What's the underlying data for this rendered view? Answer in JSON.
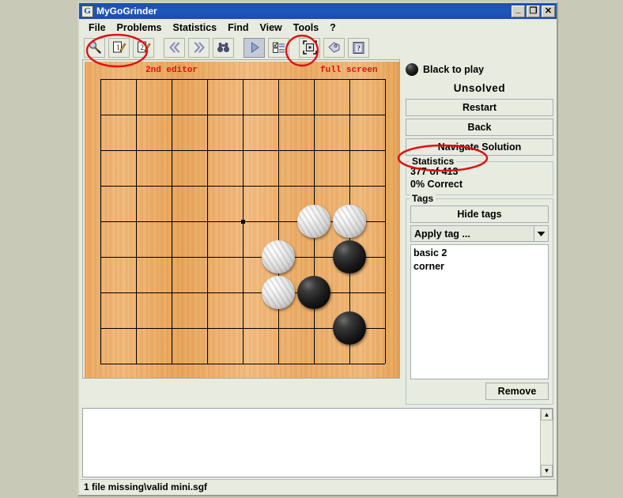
{
  "window": {
    "title": "MyGoGrinder",
    "icon": "app-icon",
    "controls": {
      "minimize": "_",
      "maximize": "❐",
      "close": "✕"
    }
  },
  "menubar": {
    "items": [
      {
        "label": "File",
        "name": "menu-file"
      },
      {
        "label": "Problems",
        "name": "menu-problems"
      },
      {
        "label": "Statistics",
        "name": "menu-statistics"
      },
      {
        "label": "Find",
        "name": "menu-find"
      },
      {
        "label": "View",
        "name": "menu-view"
      },
      {
        "label": "Tools",
        "name": "menu-tools"
      },
      {
        "label": "?",
        "name": "menu-help"
      }
    ]
  },
  "toolbar": {
    "buttons": [
      {
        "name": "magnifier-brush-icon",
        "icon": "magnifier-brush",
        "selected": false
      },
      {
        "name": "editor-1-icon",
        "icon": "edit-1",
        "selected": false
      },
      {
        "name": "editor-2-icon",
        "icon": "edit-2",
        "selected": false
      },
      {
        "name": "previous-problem-icon",
        "icon": "double-chevron-left",
        "selected": false
      },
      {
        "name": "next-problem-icon",
        "icon": "double-chevron-right",
        "selected": false
      },
      {
        "name": "search-binoculars-icon",
        "icon": "binoculars",
        "selected": false
      },
      {
        "name": "play-icon",
        "icon": "play-triangle",
        "selected": true
      },
      {
        "name": "problem-list-icon",
        "icon": "checklist",
        "selected": false
      },
      {
        "name": "full-screen-icon",
        "icon": "fullscreen-brackets",
        "selected": false
      },
      {
        "name": "tag-icon",
        "icon": "tag-label",
        "selected": false
      },
      {
        "name": "help-icon",
        "icon": "question-book",
        "selected": false
      }
    ]
  },
  "annotations": [
    {
      "text": "2nd editor",
      "name": "annotation-2nd-editor",
      "color": "#e01010"
    },
    {
      "text": "full screen",
      "name": "annotation-full-screen",
      "color": "#e01010"
    }
  ],
  "board": {
    "size": 9,
    "star_points": [
      {
        "col": 5,
        "row": 5
      }
    ],
    "stones": [
      {
        "color": "white",
        "col": 7,
        "row": 5
      },
      {
        "color": "white",
        "col": 8,
        "row": 5
      },
      {
        "color": "black",
        "col": 8,
        "row": 6
      },
      {
        "color": "white",
        "col": 6,
        "row": 6
      },
      {
        "color": "white",
        "col": 6,
        "row": 7
      },
      {
        "color": "black",
        "col": 7,
        "row": 7
      },
      {
        "color": "black",
        "col": 8,
        "row": 8
      }
    ],
    "wood_color": "#e9a963",
    "line_color": "#000000"
  },
  "side": {
    "turn": {
      "label": "Black to play",
      "stone": "black"
    },
    "solve_status": "Unsolved",
    "buttons": [
      {
        "label": "Restart",
        "name": "restart-button"
      },
      {
        "label": "Back",
        "name": "back-button"
      },
      {
        "label": "Navigate Solution",
        "name": "navigate-solution-button"
      }
    ],
    "statistics": {
      "legend": "Statistics",
      "progress": "377 of 413",
      "correct": "0% Correct"
    },
    "tags": {
      "legend": "Tags",
      "hide_button": "Hide tags",
      "combo_value": "Apply tag ...",
      "items": [
        "basic 2",
        "corner"
      ],
      "remove_button": "Remove"
    }
  },
  "comment": {
    "text": "",
    "scroll_up": "▲",
    "scroll_down": "▼"
  },
  "statusbar": {
    "text": "1 file missing\\valid mini.sgf"
  }
}
